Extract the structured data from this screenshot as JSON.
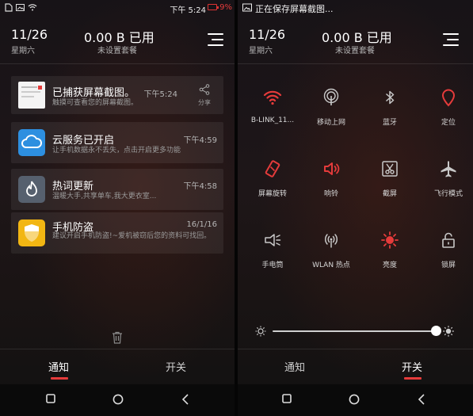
{
  "colors": {
    "accent": "#e53b3b",
    "muted": "#9b9b9b",
    "text": "#ffffff"
  },
  "left": {
    "status": {
      "time": "下午 5:24",
      "battery": "9%"
    },
    "header": {
      "date": "11/26",
      "weekday": "星期六",
      "data_used": "0.00 B 已用",
      "plan": "未设置套餐"
    },
    "notifications": [
      {
        "icon": "screenshot-thumbnail",
        "title": "已捕获屏幕截图。",
        "body": "触摸可查看您的屏幕截图。",
        "time": "下午5:24",
        "action": "分享"
      },
      {
        "icon": "cloud-icon",
        "title": "云服务已开启",
        "body": "让手机数据永不丢失，点击开启更多功能",
        "time": "下午4:59"
      },
      {
        "icon": "flame-app-icon",
        "title": "热词更新",
        "body": "温暖大手,共享单车,我大更衣室...",
        "time": "下午4:58"
      },
      {
        "icon": "shield-icon",
        "title": "手机防盗",
        "body": "建议开启手机防盗!~爱机被窃后您的资料可找回。",
        "time": "16/1/16"
      }
    ],
    "tabs": {
      "notifications": "通知",
      "toggles": "开关",
      "active": "notifications"
    }
  },
  "right": {
    "status": {
      "saving": "正在保存屏幕截图..."
    },
    "header": {
      "date": "11/26",
      "weekday": "星期六",
      "data_used": "0.00 B 已用",
      "plan": "未设置套餐"
    },
    "toggles": [
      {
        "label": "B-LINK_11...",
        "icon": "wifi-icon",
        "active": true
      },
      {
        "label": "移动上网",
        "icon": "mobile-data-icon",
        "active": false
      },
      {
        "label": "蓝牙",
        "icon": "bluetooth-icon",
        "active": false
      },
      {
        "label": "定位",
        "icon": "location-icon",
        "active": true
      },
      {
        "label": "屏幕旋转",
        "icon": "rotate-icon",
        "active": true
      },
      {
        "label": "响铃",
        "icon": "volume-icon",
        "active": true
      },
      {
        "label": "截屏",
        "icon": "screenshot-icon",
        "active": false
      },
      {
        "label": "飞行模式",
        "icon": "airplane-icon",
        "active": false
      },
      {
        "label": "手电筒",
        "icon": "flashlight-icon",
        "active": false
      },
      {
        "label": "WLAN 热点",
        "icon": "hotspot-icon",
        "active": false
      },
      {
        "label": "亮度",
        "icon": "brightness-icon",
        "active": true
      },
      {
        "label": "锁屏",
        "icon": "lock-icon",
        "active": false
      }
    ],
    "brightness": {
      "level": 1.0
    },
    "tabs": {
      "notifications": "通知",
      "toggles": "开关",
      "active": "toggles"
    }
  }
}
